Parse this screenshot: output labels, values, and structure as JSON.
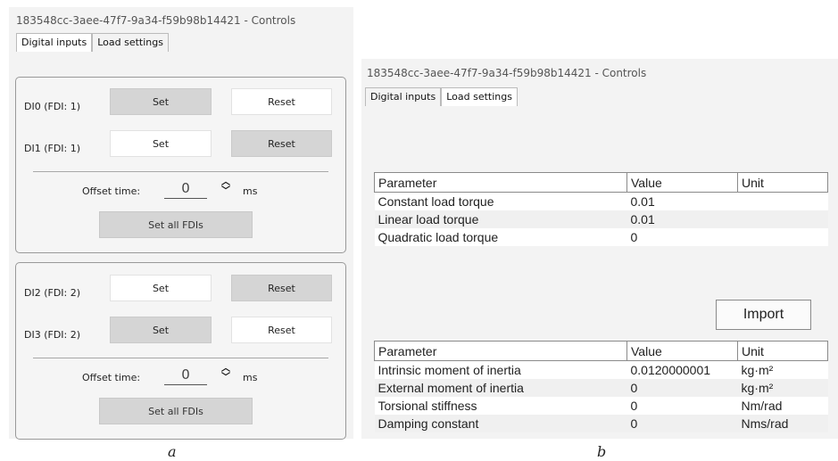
{
  "window_title": "183548cc-3aee-47f7-9a34-f59b98b14421 - Controls",
  "tabs": [
    "Digital inputs",
    "Load settings"
  ],
  "panel_a": {
    "groups": [
      {
        "rows": [
          {
            "label": "DI0 (FDI: 1)",
            "set": "Set",
            "reset": "Reset",
            "active": "reset"
          },
          {
            "label": "DI1 (FDI: 1)",
            "set": "Set",
            "reset": "Reset",
            "active": "set"
          }
        ],
        "offset_label": "Offset time:",
        "offset_value": "0",
        "offset_unit": "ms",
        "set_all": "Set all FDIs"
      },
      {
        "rows": [
          {
            "label": "DI2 (FDI: 2)",
            "set": "Set",
            "reset": "Reset",
            "active": "set"
          },
          {
            "label": "DI3 (FDI: 2)",
            "set": "Set",
            "reset": "Reset",
            "active": "reset"
          }
        ],
        "offset_label": "Offset time:",
        "offset_value": "0",
        "offset_unit": "ms",
        "set_all": "Set all FDIs"
      }
    ]
  },
  "panel_b": {
    "load_table": {
      "headers": [
        "Parameter",
        "Value",
        "Unit"
      ],
      "rows": [
        [
          "Constant load torque",
          "0.01",
          ""
        ],
        [
          "Linear load torque",
          "0.01",
          ""
        ],
        [
          "Quadratic load torque",
          "0",
          ""
        ]
      ]
    },
    "import_label": "Import",
    "inertia_table": {
      "headers": [
        "Parameter",
        "Value",
        "Unit"
      ],
      "rows": [
        [
          "Intrinsic moment of inertia",
          "0.0120000001",
          "kg·m²"
        ],
        [
          "External moment of inertia",
          "0",
          "kg·m²"
        ],
        [
          "Torsional stiffness",
          "0",
          "Nm/rad"
        ],
        [
          "Damping constant",
          "0",
          "Nms/rad"
        ]
      ]
    }
  },
  "captions": [
    "a",
    "b"
  ],
  "icons": {
    "spin_up": "chevron-up-icon",
    "spin_down": "chevron-down-icon"
  }
}
